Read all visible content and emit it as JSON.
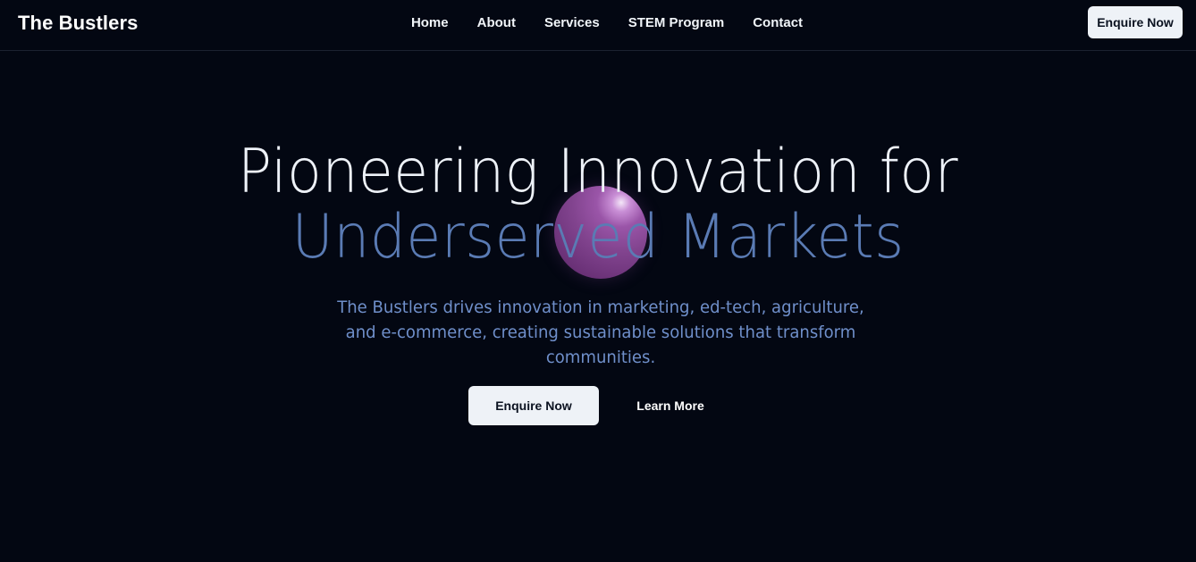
{
  "header": {
    "brand": "The Bustlers",
    "nav": [
      {
        "label": "Home"
      },
      {
        "label": "About"
      },
      {
        "label": "Services"
      },
      {
        "label": "STEM Program"
      },
      {
        "label": "Contact"
      }
    ],
    "cta_label": "Enquire Now"
  },
  "hero": {
    "headline_line1": "Pioneering Innovation for",
    "headline_line2": "Underserved Markets",
    "subtitle": "The Bustlers drives innovation in marketing, ed-tech, agriculture, and e-commerce, creating sustainable solutions that transform communities.",
    "primary_cta": "Enquire Now",
    "secondary_cta": "Learn More"
  },
  "colors": {
    "background": "#030712",
    "accent_blue": "#5a7bb4",
    "button_bg": "#eef2f7",
    "orb": "#82448f"
  }
}
